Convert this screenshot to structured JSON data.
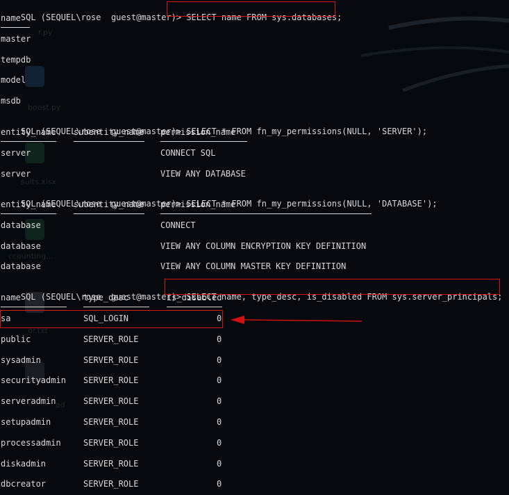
{
  "terminal": {
    "prompt": "SQL (SEQUEL\\rose  guest@master)> ",
    "q1": {
      "command": "SELECT name FROM sys.databases;",
      "header": "name",
      "rows": [
        "master",
        "tempdb",
        "model",
        "msdb"
      ]
    },
    "q2": {
      "command": "SELECT * FROM fn_my_permissions(NULL, 'SERVER');",
      "headers": [
        "entity_name",
        "subentity_name",
        "permission_name"
      ],
      "rows": [
        [
          "server",
          "",
          "CONNECT SQL"
        ],
        [
          "server",
          "",
          "VIEW ANY DATABASE"
        ]
      ]
    },
    "q3": {
      "command": "SELECT * FROM fn_my_permissions(NULL, 'DATABASE');",
      "headers": [
        "entity_name",
        "subentity_name",
        "permission_name"
      ],
      "rows": [
        [
          "database",
          "",
          "CONNECT"
        ],
        [
          "database",
          "",
          "VIEW ANY COLUMN ENCRYPTION KEY DEFINITION"
        ],
        [
          "database",
          "",
          "VIEW ANY COLUMN MASTER KEY DEFINITION"
        ]
      ]
    },
    "q4": {
      "command": "SELECT name, type_desc, is_disabled FROM sys.server_principals;",
      "headers": [
        "name",
        "type_desc",
        "is_disabled"
      ],
      "rows": [
        [
          "sa",
          "SQL_LOGIN",
          "0"
        ],
        [
          "public",
          "SERVER_ROLE",
          "0"
        ],
        [
          "sysadmin",
          "SERVER_ROLE",
          "0"
        ],
        [
          "securityadmin",
          "SERVER_ROLE",
          "0"
        ],
        [
          "serveradmin",
          "SERVER_ROLE",
          "0"
        ],
        [
          "setupadmin",
          "SERVER_ROLE",
          "0"
        ],
        [
          "processadmin",
          "SERVER_ROLE",
          "0"
        ],
        [
          "diskadmin",
          "SERVER_ROLE",
          "0"
        ],
        [
          "dbcreator",
          "SERVER_ROLE",
          "0"
        ]
      ]
    }
  },
  "desktop_ghosts": [
    "r.py",
    "boost.py",
    "sults.xlsx",
    "ccounting...",
    "or.txt",
    "ad"
  ],
  "colors": {
    "background": "#06090d",
    "text": "#d9d9d9",
    "annotation": "#d11111"
  }
}
